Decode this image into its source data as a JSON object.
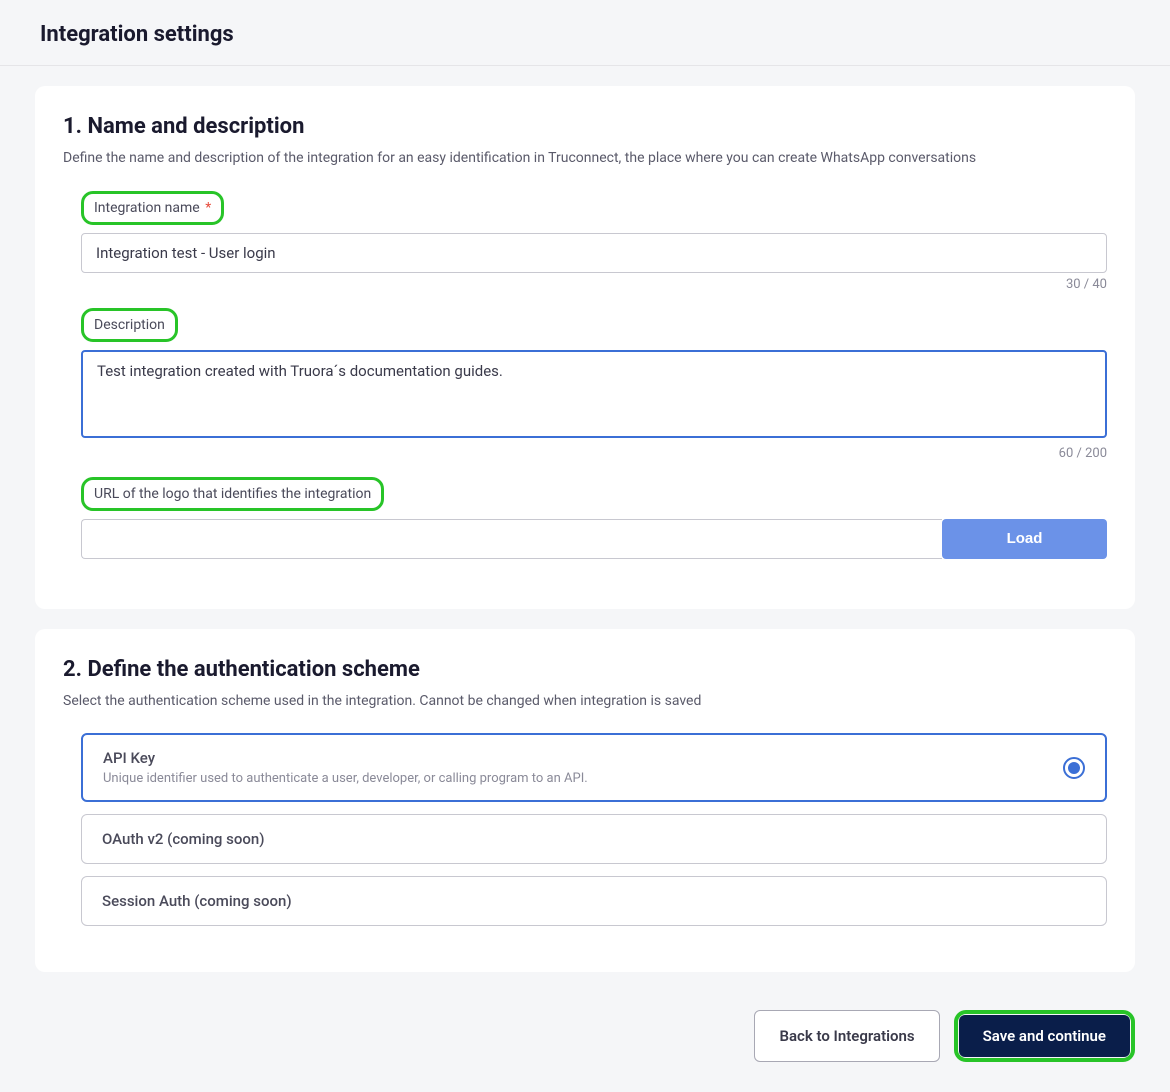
{
  "page": {
    "title": "Integration settings"
  },
  "section1": {
    "title": "1. Name and description",
    "desc": "Define the name and description of the integration for an easy identification in Truconnect, the place where you can create WhatsApp conversations",
    "name_label": "Integration name",
    "name_value": "Integration test - User login",
    "name_counter": "30 / 40",
    "desc_label": "Description",
    "desc_value": "Test integration created with Truora´s documentation guides.",
    "desc_counter": "60 / 200",
    "url_label": "URL of the logo that identifies the integration",
    "url_value": "",
    "load_btn": "Load"
  },
  "section2": {
    "title": "2. Define the authentication scheme",
    "desc": "Select the authentication scheme used in the integration. Cannot be changed when integration is saved",
    "options": [
      {
        "name": "API Key",
        "desc": "Unique identifier used to authenticate a user, developer, or calling program to an API.",
        "selected": true
      },
      {
        "name": "OAuth v2 (coming soon)",
        "desc": "",
        "selected": false
      },
      {
        "name": "Session Auth (coming soon)",
        "desc": "",
        "selected": false
      }
    ]
  },
  "footer": {
    "back": "Back to Integrations",
    "save": "Save and continue"
  }
}
